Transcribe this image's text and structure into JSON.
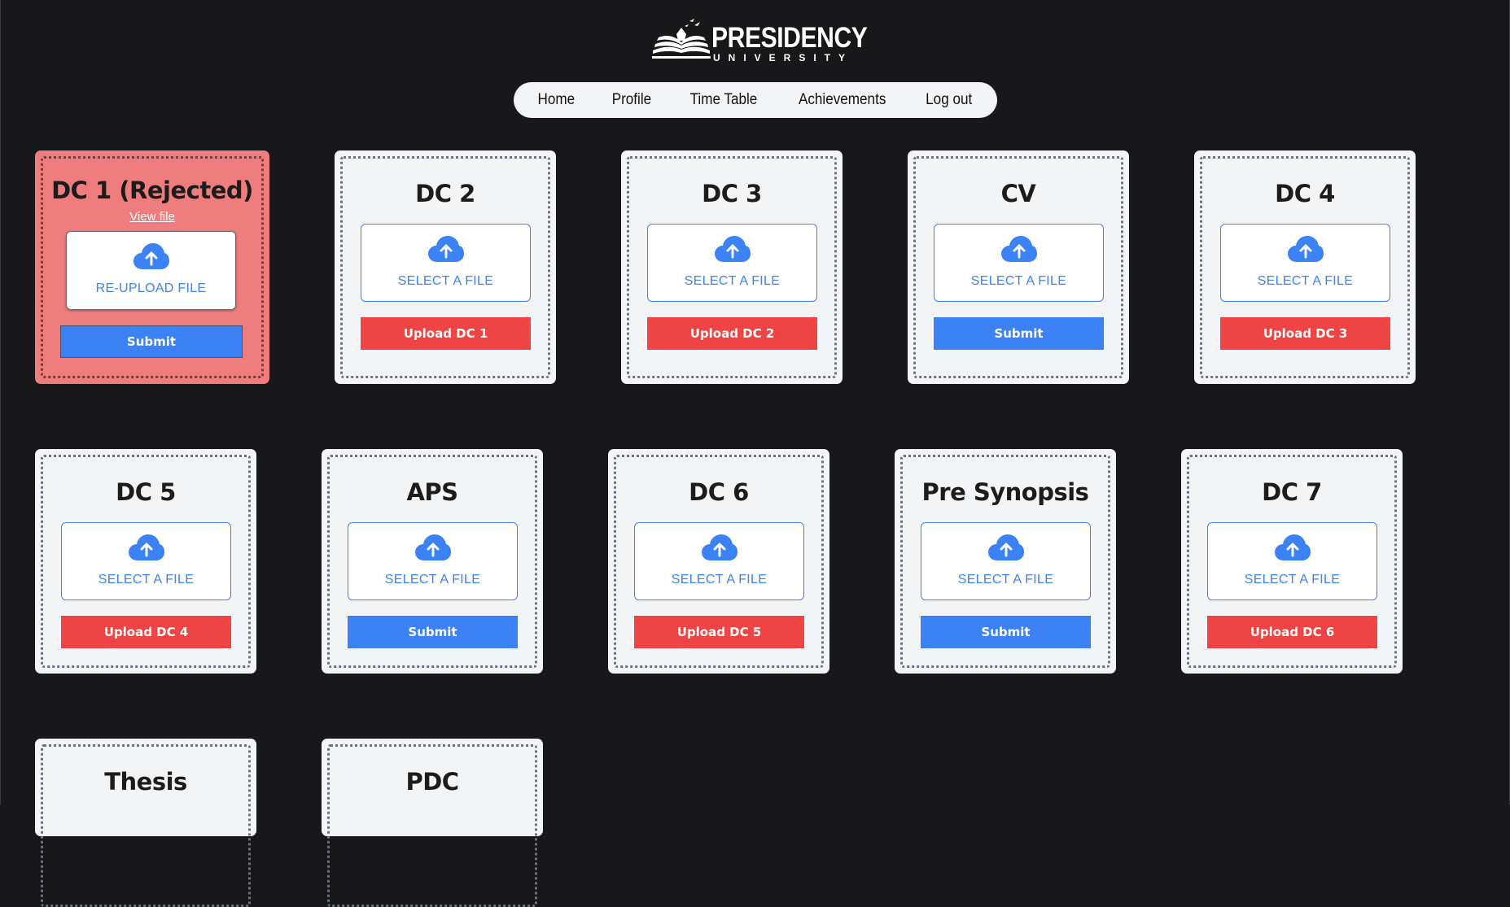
{
  "logo": {
    "name": "PRESIDENCY",
    "sub": "UNIVERSITY"
  },
  "nav": {
    "items": [
      "Home",
      "Profile",
      "Time Table",
      "Achievements",
      "Log out"
    ]
  },
  "colors": {
    "page_bg": "#18181b",
    "card_bg": "#f3f4f6",
    "rejected_bg": "#f07d7d",
    "upload_button": "#ef4444",
    "submit_button": "#3b82f6",
    "accent_blue": "#3b82f6"
  },
  "cards": [
    {
      "title": "DC 1 (Rejected)",
      "status": "rejected",
      "view_file": "View file",
      "select_label": "RE-UPLOAD FILE",
      "button": "Submit",
      "button_color": "blue",
      "icon": "cloud-upload-icon"
    },
    {
      "title": "DC 2",
      "select_label": "SELECT A FILE",
      "button": "Upload DC 1",
      "button_color": "red",
      "icon": "cloud-upload-icon"
    },
    {
      "title": "DC 3",
      "select_label": "SELECT A FILE",
      "button": "Upload DC 2",
      "button_color": "red",
      "icon": "cloud-upload-icon"
    },
    {
      "title": "CV",
      "select_label": "SELECT A FILE",
      "button": "Submit",
      "button_color": "blue",
      "icon": "cloud-upload-icon"
    },
    {
      "title": "DC 4",
      "select_label": "SELECT A FILE",
      "button": "Upload DC 3",
      "button_color": "red",
      "icon": "cloud-upload-icon"
    },
    {
      "title": "DC 5",
      "select_label": "SELECT A FILE",
      "button": "Upload DC 4",
      "button_color": "red",
      "icon": "cloud-upload-icon"
    },
    {
      "title": "APS",
      "select_label": "SELECT A FILE",
      "button": "Submit",
      "button_color": "blue",
      "icon": "cloud-upload-icon"
    },
    {
      "title": "DC 6",
      "select_label": "SELECT A FILE",
      "button": "Upload DC 5",
      "button_color": "red",
      "icon": "cloud-upload-icon"
    },
    {
      "title": "Pre Synopsis",
      "select_label": "SELECT A FILE",
      "button": "Submit",
      "button_color": "blue",
      "icon": "cloud-upload-icon"
    },
    {
      "title": "DC 7",
      "select_label": "SELECT A FILE",
      "button": "Upload DC 6",
      "button_color": "red",
      "icon": "cloud-upload-icon"
    },
    {
      "title": "Thesis"
    },
    {
      "title": "PDC"
    }
  ]
}
